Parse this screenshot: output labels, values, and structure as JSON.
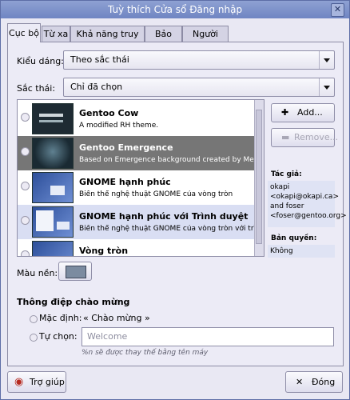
{
  "window": {
    "title": "Tuỳ thích Cửa sổ Đăng nhập"
  },
  "tabs": [
    "Cục bộ",
    "Từ xa",
    "Khả năng truy cập",
    "Bảo mật",
    "Người dùng"
  ],
  "style": {
    "label": "Kiểu dáng:",
    "value": "Theo sắc thái"
  },
  "theme": {
    "label": "Sắc thái:",
    "value": "Chỉ đã chọn"
  },
  "themes": [
    {
      "title": "Gentoo Cow",
      "desc": "A modified RH theme."
    },
    {
      "title": "Gentoo Emergence",
      "desc": "Based on Emergence background created by Meir Kriheli"
    },
    {
      "title": "GNOME hạnh phúc",
      "desc": "Biến thể nghệ thuật GNOME của vòng tròn"
    },
    {
      "title": "GNOME hạnh phúc với Trình duyệt",
      "desc": "Biến thể nghệ thuật GNOME của vòng tròn với trình duyệt"
    },
    {
      "title": "Vòng tròn",
      "desc": ""
    }
  ],
  "buttons": {
    "add": "Add...",
    "remove": "Remove...",
    "help": "Trợ giúp",
    "close": "Đóng"
  },
  "author": {
    "label": "Tác giả:",
    "value": "okapi <okapi@okapi.ca> and foser <foser@gentoo.org>"
  },
  "copyright": {
    "label": "Bản quyền:",
    "value": "Không"
  },
  "background": {
    "label": "Màu nền:",
    "color": "#7b8ba0"
  },
  "welcome": {
    "heading": "Thông điệp chào mừng",
    "default_label": "Mặc định:",
    "default_value": "« Chào mừng »",
    "custom_label": "Tự chọn:",
    "custom_placeholder": "Welcome",
    "note": "%n sẽ được thay thế bằng tên máy"
  }
}
